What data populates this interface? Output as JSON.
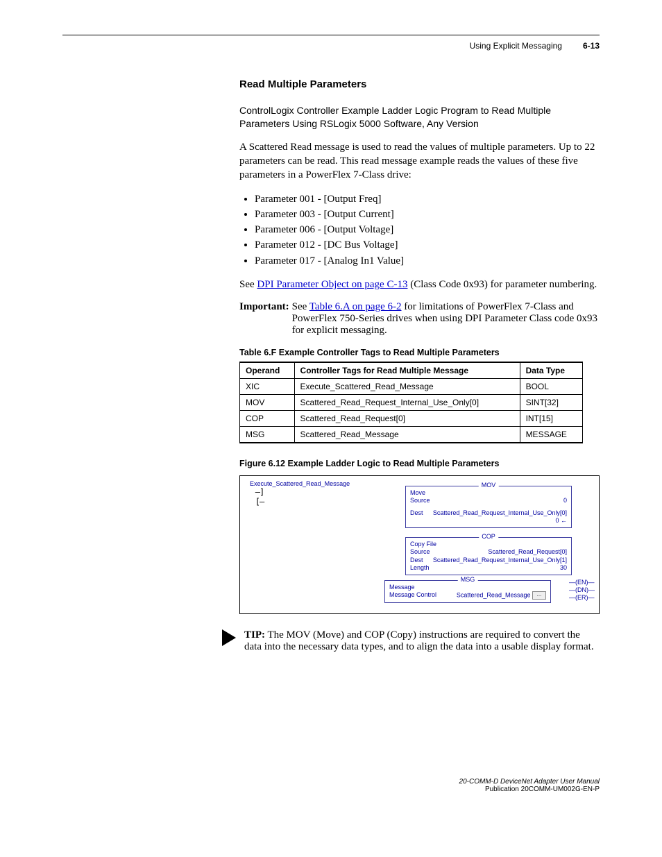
{
  "header": {
    "chapter": "Using Explicit Messaging",
    "pagenum": "6-13"
  },
  "section_title": "Read Multiple Parameters",
  "para_intro": "ControlLogix Controller Example Ladder Logic Program to Read Multiple Parameters Using RSLogix 5000 Software, Any Version",
  "para_scattered": "A Scattered Read message is used to read the values of multiple parameters. Up to 22 parameters can be read. This read message example reads the values of these five parameters in a PowerFlex 7-Class drive:",
  "param_list": [
    "Parameter 001 - [Output Freq]",
    "Parameter 003 - [Output Current]",
    "Parameter 006 - [Output Voltage]",
    "Parameter 012 - [DC Bus Voltage]",
    "Parameter 017 - [Analog In1 Value]"
  ],
  "see_prefix": "See ",
  "see_link": "DPI Parameter Object on page C-13",
  "see_suffix": " (Class Code 0x93) for parameter numbering.",
  "important_label": "Important:",
  "important_prefix": "See ",
  "important_link": "Table 6.A on page 6-2",
  "important_suffix": " for limitations of PowerFlex 7-Class and PowerFlex 750-Series drives when using DPI Parameter Class code 0x93 for explicit messaging.",
  "table_title": "Table 6.F    Example Controller Tags to Read Multiple Parameters",
  "table": {
    "headers": [
      "Operand",
      "Controller Tags for Read Multiple Message",
      "Data Type"
    ],
    "rows": [
      [
        "XIC",
        "Execute_Scattered_Read_Message",
        "BOOL"
      ],
      [
        "MOV",
        "Scattered_Read_Request_Internal_Use_Only[0]",
        "SINT[32]"
      ],
      [
        "COP",
        "Scattered_Read_Request[0]",
        "INT[15]"
      ],
      [
        "MSG",
        "Scattered_Read_Message",
        "MESSAGE"
      ]
    ]
  },
  "figure_title": "Figure 6.12   Example Ladder Logic to Read Multiple Parameters",
  "diagram": {
    "xic_tag": "Execute_Scattered_Read_Message",
    "mov": {
      "title": "MOV",
      "l1": "Move",
      "source_lbl": "Source",
      "source_val": "0",
      "dest_lbl": "Dest",
      "dest_val": "Scattered_Read_Request_Internal_Use_Only[0]",
      "dest_sub": "0"
    },
    "cop": {
      "title": "COP",
      "l1": "Copy File",
      "source_lbl": "Source",
      "source_val": "Scattered_Read_Request[0]",
      "dest_lbl": "Dest",
      "dest_val": "Scattered_Read_Request_Internal_Use_Only[1]",
      "len_lbl": "Length",
      "len_val": "30"
    },
    "msg": {
      "title": "MSG",
      "l1": "Message",
      "ctrl_lbl": "Message Control",
      "ctrl_val": "Scattered_Read_Message"
    },
    "coils": [
      "EN",
      "DN",
      "ER"
    ]
  },
  "tip_label": "TIP:",
  "tip_body": "  The MOV (Move) and COP (Copy) instructions are required to convert the data into the necessary data types, and to align the data into a usable display format.",
  "footer": {
    "line1": "20-COMM-D DeviceNet Adapter User Manual",
    "line2": "Publication 20COMM-UM002G-EN-P"
  }
}
